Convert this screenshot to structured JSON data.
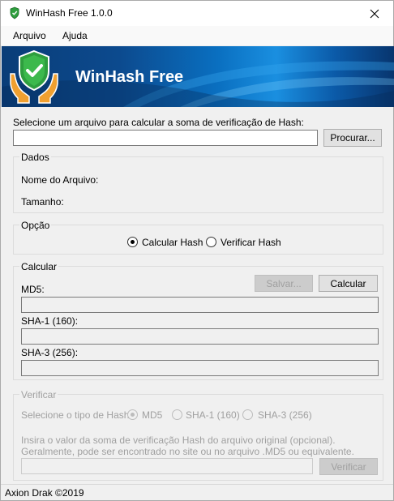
{
  "window": {
    "title": "WinHash Free 1.0.0"
  },
  "menu": {
    "items": [
      "Arquivo",
      "Ajuda"
    ]
  },
  "banner": {
    "app_name": "WinHash Free"
  },
  "file": {
    "prompt": "Selecione um arquivo para calcular a soma de verificação de Hash:",
    "path_value": "",
    "browse_label": "Procurar..."
  },
  "dados": {
    "title": "Dados",
    "filename_label": "Nome do Arquivo:",
    "size_label": "Tamanho:"
  },
  "opcao": {
    "title": "Opção",
    "calc_label": "Calcular Hash",
    "verify_label": "Verificar Hash",
    "selected": "calc"
  },
  "calcular": {
    "title": "Calcular",
    "save_label": "Salvar...",
    "calc_label": "Calcular",
    "md5_label": "MD5:",
    "sha1_label": "SHA-1 (160):",
    "sha3_label": "SHA-3 (256):",
    "md5_value": "",
    "sha1_value": "",
    "sha3_value": ""
  },
  "verificar": {
    "title": "Verificar",
    "type_label": "Selecione o tipo de Hash:",
    "opt_md5": "MD5",
    "opt_sha1": "SHA-1 (160)",
    "opt_sha3": "SHA-3 (256)",
    "selected": "md5",
    "hint_line1": "Insira o valor da soma de verificação Hash do arquivo original (opcional).",
    "hint_line2": "Geralmente, pode ser encontrado no site ou no arquivo .MD5 ou equivalente.",
    "hash_value": "",
    "verify_label": "Verificar"
  },
  "status": {
    "text": "Axion Drak ©2019"
  },
  "colors": {
    "banner_dark": "#0a3d78",
    "banner_light": "#1a8fe0",
    "shield_green": "#2e9e3e",
    "hands_orange": "#f0a030"
  }
}
